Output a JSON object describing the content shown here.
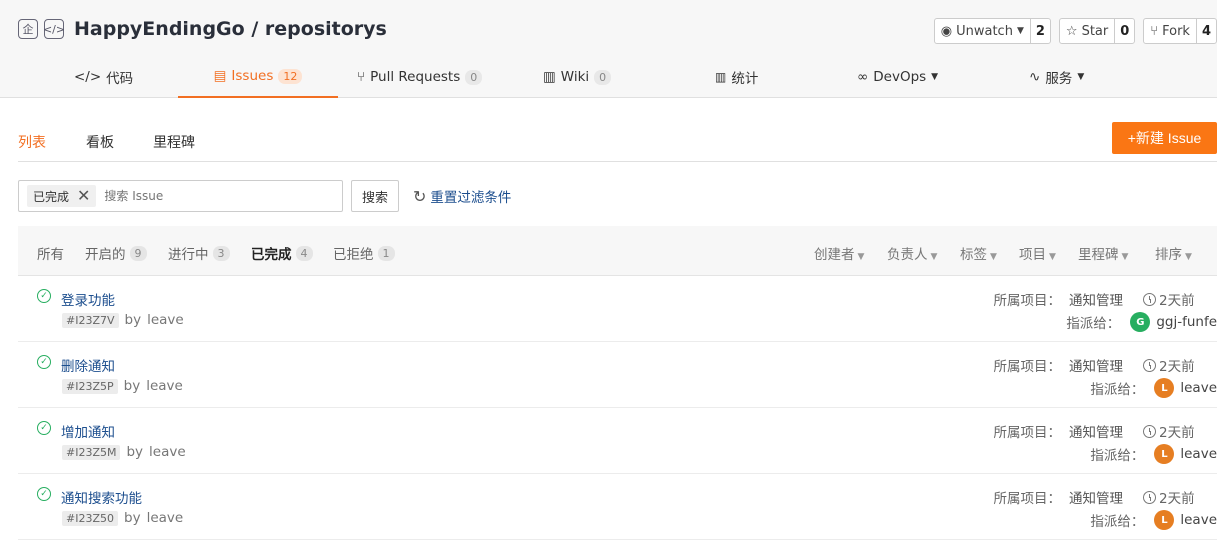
{
  "repo": {
    "owner": "HappyEndingGo",
    "sep": "/",
    "name": "repositorys"
  },
  "actions": {
    "watch": {
      "label": "Unwatch",
      "count": "2"
    },
    "star": {
      "label": "Star",
      "count": "0"
    },
    "fork": {
      "label": "Fork",
      "count": "4"
    }
  },
  "tabs": [
    {
      "icon": "</>",
      "label": "代码",
      "count": ""
    },
    {
      "icon": "▤",
      "label": "Issues",
      "count": "12"
    },
    {
      "icon": "⑂",
      "label": "Pull Requests",
      "count": "0"
    },
    {
      "icon": "▥",
      "label": "Wiki",
      "count": "0"
    },
    {
      "icon": "📊",
      "label": "统计",
      "count": ""
    },
    {
      "icon": "∞",
      "label": "DevOps",
      "count": ""
    },
    {
      "icon": "∿",
      "label": "服务",
      "count": ""
    }
  ],
  "subtabs": {
    "list": "列表",
    "board": "看板",
    "milestones": "里程碑"
  },
  "new_issue": "+新建 Issue",
  "search": {
    "chip": "已完成",
    "placeholder": "搜索 Issue",
    "button": "搜索",
    "reset": "重置过滤条件"
  },
  "states": [
    {
      "label": "所有",
      "count": ""
    },
    {
      "label": "开启的",
      "count": "9"
    },
    {
      "label": "进行中",
      "count": "3"
    },
    {
      "label": "已完成",
      "count": "4"
    },
    {
      "label": "已拒绝",
      "count": "1"
    }
  ],
  "filters": {
    "creator": "创建者",
    "assignee": "负责人",
    "labels": "标签",
    "project": "项目",
    "milestone": "里程碑",
    "sort": "排序"
  },
  "issue_labels": {
    "project": "所属项目：",
    "assigned": "指派给：",
    "by": "by"
  },
  "issues": [
    {
      "title": "登录功能",
      "id": "#I23Z7V",
      "author": "leave",
      "project": "通知管理",
      "time": "2天前",
      "assignee": "ggj-funfe",
      "avatar_letter": "G",
      "avatar_color": "#27ae60"
    },
    {
      "title": "删除通知",
      "id": "#I23Z5P",
      "author": "leave",
      "project": "通知管理",
      "time": "2天前",
      "assignee": "leave",
      "avatar_letter": "L",
      "avatar_color": "#e67e22"
    },
    {
      "title": "增加通知",
      "id": "#I23Z5M",
      "author": "leave",
      "project": "通知管理",
      "time": "2天前",
      "assignee": "leave",
      "avatar_letter": "L",
      "avatar_color": "#e67e22"
    },
    {
      "title": "通知搜索功能",
      "id": "#I23Z50",
      "author": "leave",
      "project": "通知管理",
      "time": "2天前",
      "assignee": "leave",
      "avatar_letter": "L",
      "avatar_color": "#e67e22"
    }
  ]
}
